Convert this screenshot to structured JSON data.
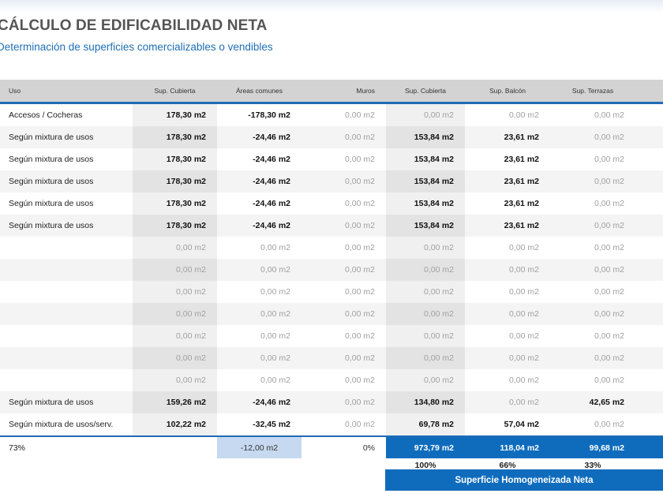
{
  "title": "CÁLCULO DE EDIFICABILIDAD NETA",
  "subtitle": "Determinación de superficies comercializables o vendibles",
  "headers": [
    "Uso",
    "Sup. Cubierta",
    "Áreas comunes",
    "Muros",
    "Sup. Cubierta",
    "Sup. Balcón",
    "Sup. Terrazas"
  ],
  "rows": [
    [
      "Accesos / Cocheras",
      "178,30 m2",
      "-178,30 m2",
      "0,00 m2",
      "0,00 m2",
      "0,00 m2",
      "0,00 m2"
    ],
    [
      "Según mixtura de usos",
      "178,30 m2",
      "-24,46 m2",
      "0,00 m2",
      "153,84 m2",
      "23,61 m2",
      "0,00 m2"
    ],
    [
      "Según mixtura de usos",
      "178,30 m2",
      "-24,46 m2",
      "0,00 m2",
      "153,84 m2",
      "23,61 m2",
      "0,00 m2"
    ],
    [
      "Según mixtura de usos",
      "178,30 m2",
      "-24,46 m2",
      "0,00 m2",
      "153,84 m2",
      "23,61 m2",
      "0,00 m2"
    ],
    [
      "Según mixtura de usos",
      "178,30 m2",
      "-24,46 m2",
      "0,00 m2",
      "153,84 m2",
      "23,61 m2",
      "0,00 m2"
    ],
    [
      "Según mixtura de usos",
      "178,30 m2",
      "-24,46 m2",
      "0,00 m2",
      "153,84 m2",
      "23,61 m2",
      "0,00 m2"
    ],
    [
      "",
      "0,00 m2",
      "0,00 m2",
      "0,00 m2",
      "0,00 m2",
      "0,00 m2",
      "0,00 m2"
    ],
    [
      "",
      "0,00 m2",
      "0,00 m2",
      "0,00 m2",
      "0,00 m2",
      "0,00 m2",
      "0,00 m2"
    ],
    [
      "",
      "0,00 m2",
      "0,00 m2",
      "0,00 m2",
      "0,00 m2",
      "0,00 m2",
      "0,00 m2"
    ],
    [
      "",
      "0,00 m2",
      "0,00 m2",
      "0,00 m2",
      "0,00 m2",
      "0,00 m2",
      "0,00 m2"
    ],
    [
      "",
      "0,00 m2",
      "0,00 m2",
      "0,00 m2",
      "0,00 m2",
      "0,00 m2",
      "0,00 m2"
    ],
    [
      "",
      "0,00 m2",
      "0,00 m2",
      "0,00 m2",
      "0,00 m2",
      "0,00 m2",
      "0,00 m2"
    ],
    [
      "",
      "0,00 m2",
      "0,00 m2",
      "0,00 m2",
      "0,00 m2",
      "0,00 m2",
      "0,00 m2"
    ],
    [
      "Según mixtura de usos",
      "159,26 m2",
      "-24,46 m2",
      "0,00 m2",
      "134,80 m2",
      "0,00 m2",
      "42,65 m2"
    ],
    [
      "Según mixtura de usos/serv.",
      "102,22 m2",
      "-32,45 m2",
      "0,00 m2",
      "69,78 m2",
      "57,04 m2",
      "0,00 m2"
    ]
  ],
  "totals": {
    "uso": "73%",
    "sup_cubierta": "",
    "areas_comunes": "-12,00 m2",
    "muros": "0%",
    "sup_cubierta_vend": "973,79 m2",
    "sup_balcon": "118,04 m2",
    "sup_terrazas": "99,68 m2"
  },
  "percentages": {
    "sup_cubierta": "100%",
    "sup_balcon": "66%",
    "sup_terrazas": "33%"
  },
  "net_label": "Superficie Homogeneizada Neta",
  "colors": {
    "accent_blue": "#0f6cbd",
    "light_blue": "#c6d9f0",
    "subtitle_blue": "#1f6fb5",
    "header_gray": "#d3d3d3"
  }
}
